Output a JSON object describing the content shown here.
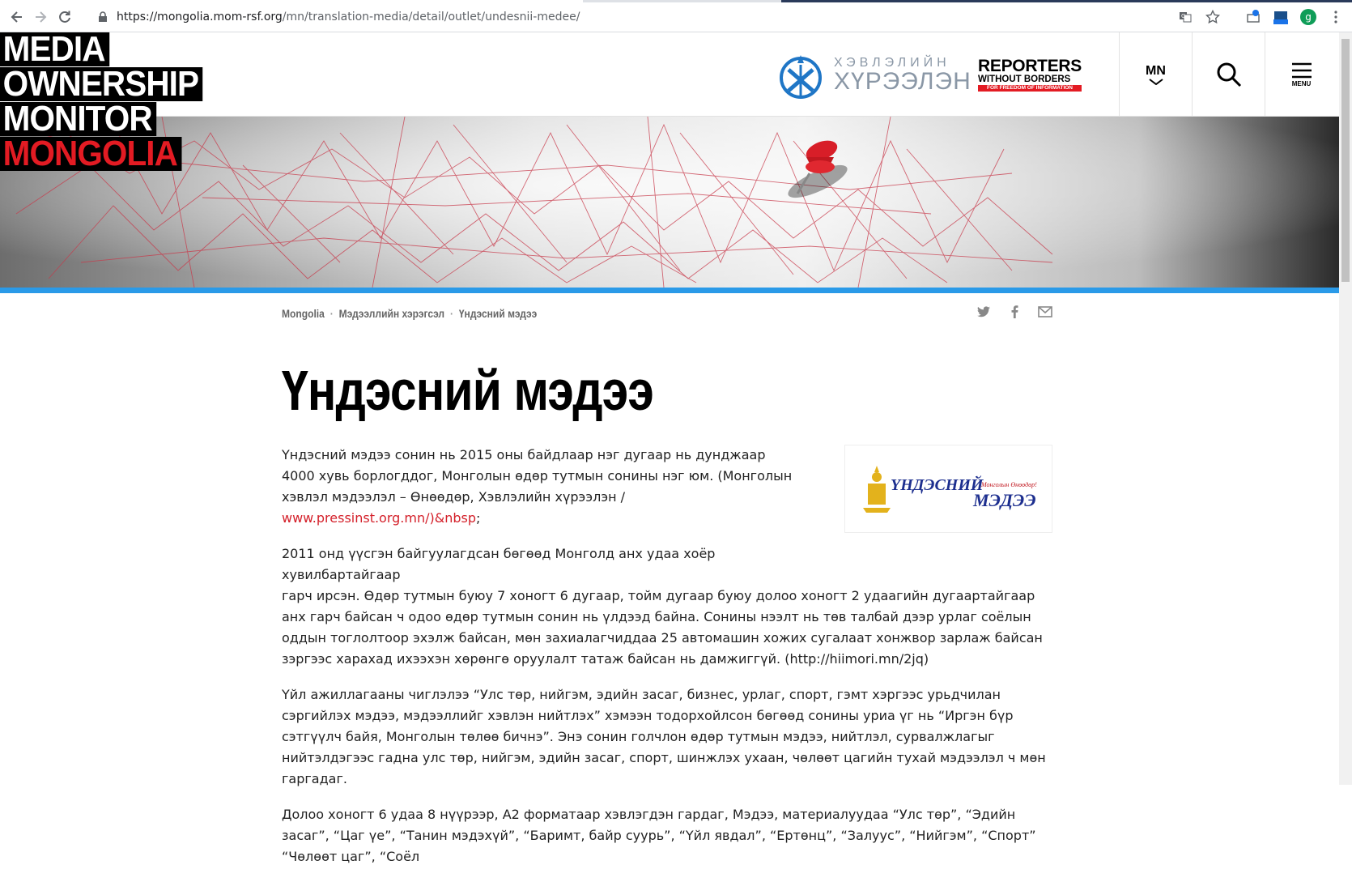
{
  "browser": {
    "url_host": "https://mongolia.mom-rsf.org",
    "url_path": "/mn/translation-media/detail/outlet/undesnii-medee/",
    "extension_badge": "4"
  },
  "header": {
    "logo_lines": [
      "MEDIA",
      "OWNERSHIP",
      "MONITOR",
      "MONGOLIA"
    ],
    "press_small": "ХЭВЛЭЛИЙН",
    "press_big": "ХҮРЭЭЛЭН",
    "rsf_top": "REPORTERS",
    "rsf_mid": "WITHOUT BORDERS",
    "rsf_bar": "FOR FREEDOM OF INFORMATION",
    "lang": "MN",
    "menu": "MENU"
  },
  "breadcrumb": [
    "Mongolia",
    "Мэдээллийн хэрэгсэл",
    "Үндэсний мэдээ"
  ],
  "page_title": "Үндэсний мэдээ",
  "outlet_logo": {
    "name": "ҮНДЭСНИЙ МЭДЭЭ",
    "tagline": "Монголын Өнөөдөр!"
  },
  "article": {
    "p1_text": "Үндэсний мэдээ сонин нь 2015 оны байдлаар нэг дугаар нь дунджаар 4000 хувь борлогддог, Монголын өдөр тутмын сонины нэг юм. (Монголын хэвлэл мэдээлэл – Өнөөдөр, Хэвлэлийн хүрээлэн / ",
    "p1_link": "www.pressinst.org.mn/)&nbsp",
    "p1_end": ";",
    "p2_first": "2011 онд үүсгэн байгуулагдсан бөгөөд Монголд анх удаа хоёр хувилбартайгаар",
    "p2_rest": "гарч ирсэн. Өдөр тутмын буюу 7 хоногт 6 дугаар, тойм дугаар буюу долоо хоногт 2 удаагийн дугаартайгаар анх гарч байсан ч одоо өдөр тутмын сонин нь үлдээд байна. Сонины нээлт нь төв талбай дээр урлаг соёлын оддын тоглолтоор эхэлж байсан, мөн захиалагчиддаа 25 автомашин хожих сугалаат хонжвор зарлаж байсан зэргээс харахад ихээхэн хөрөнгө оруулалт татаж байсан нь дамжиггүй. (http://hiimori.mn/2jq)",
    "p3": "Үйл ажиллагааны чиглэлээ “Улс төр, нийгэм, эдийн засаг, бизнес, урлаг, спорт, гэмт хэргээс урьдчилан сэргийлэх мэдээ, мэдээллийг хэвлэн нийтлэх” хэмээн тодорхойлсон бөгөөд сонины уриа үг нь “Иргэн бүр сэтгүүлч байя, Монголын төлөө бичнэ”. Энэ сонин голчлон өдөр тутмын мэдээ, нийтлэл, сурвалжлагыг нийтэлдэгээс гадна улс төр, нийгэм, эдийн засаг, спорт, шинжлэх ухаан, чөлөөт цагийн тухай мэдээлэл ч мөн гаргадаг.",
    "p4": "Долоо хоногт 6 удаа 8 нүүрээр, А2 форматаар хэвлэгдэн гардаг, Мэдээ, материалуудаа “Улс төр”, “Эдийн засаг”, “Цаг үе”, “Танин мэдэхүй”, “Баримт, байр суурь”, “Үйл явдал”, “Ертөнц”, “Залуус”, “Нийгэм”, “Спорт” “Чөлөөт цаг”, “Соёл"
  },
  "colors": {
    "accent_red": "#e31b23",
    "link_red": "#d4202a",
    "stripe_blue": "#2a9ae8"
  }
}
